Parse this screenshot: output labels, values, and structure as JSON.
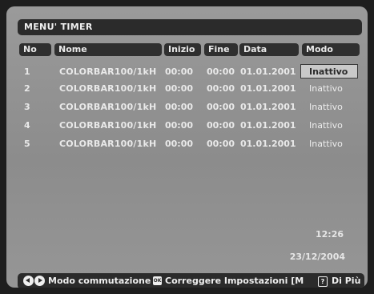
{
  "title": "MENU' TIMER",
  "columns": {
    "no": "No",
    "nome": "Nome",
    "inizio": "Inizio",
    "fine": "Fine",
    "data": "Data",
    "modo": "Modo"
  },
  "rows": [
    {
      "no": "1",
      "nome": "COLORBAR100/1kH",
      "inizio": "00:00",
      "fine": "00:00",
      "data": "01.01.2001",
      "modo": "Inattivo"
    },
    {
      "no": "2",
      "nome": "COLORBAR100/1kH",
      "inizio": "00:00",
      "fine": "00:00",
      "data": "01.01.2001",
      "modo": "Inattivo"
    },
    {
      "no": "3",
      "nome": "COLORBAR100/1kH",
      "inizio": "00:00",
      "fine": "00:00",
      "data": "01.01.2001",
      "modo": "Inattivo"
    },
    {
      "no": "4",
      "nome": "COLORBAR100/1kH",
      "inizio": "00:00",
      "fine": "00:00",
      "data": "01.01.2001",
      "modo": "Inattivo"
    },
    {
      "no": "5",
      "nome": "COLORBAR100/1kH",
      "inizio": "00:00",
      "fine": "00:00",
      "data": "01.01.2001",
      "modo": "Inattivo"
    }
  ],
  "selected_row": 1,
  "clock": {
    "time": "12:26",
    "date": "23/12/2004"
  },
  "footer": {
    "switch_label": "Modo commutazione",
    "ok_icon": "ok-icon",
    "correct_label": "Correggere Impostazioni [M",
    "help_icon": "help-icon",
    "more_label": "Di Più"
  },
  "colors": {
    "background": "#8c8c8c",
    "bar": "#2b2b2b",
    "text": "#e9e9e9"
  }
}
